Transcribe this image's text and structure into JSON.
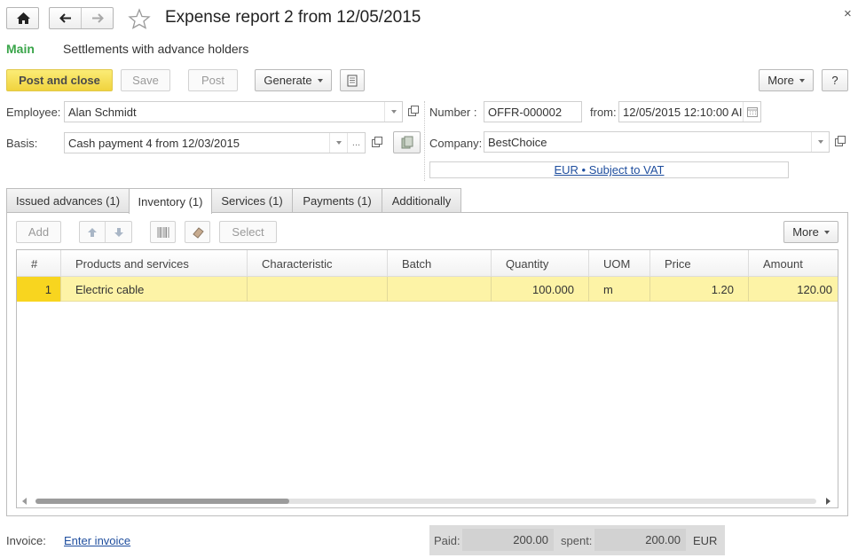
{
  "window": {
    "title": "Expense report 2 from 12/05/2015",
    "close_glyph": "×"
  },
  "nav": {
    "main_label": "Main",
    "settlements_label": "Settlements with advance holders"
  },
  "toolbar": {
    "post_close_label": "Post and close",
    "save_label": "Save",
    "post_label": "Post",
    "generate_label": "Generate",
    "more_label": "More",
    "help_label": "?"
  },
  "form": {
    "employee_label": "Employee:",
    "employee_value": "Alan Schmidt",
    "basis_label": "Basis:",
    "basis_value": "Cash payment 4 from 12/03/2015",
    "basis_ellipsis": "...",
    "number_label": "Number :",
    "number_value": "OFFR-000002",
    "from_label": "from:",
    "from_value": "12/05/2015 12:10:00 AI",
    "company_label": "Company:",
    "company_value": "BestChoice",
    "currency_link": "EUR • Subject to VAT"
  },
  "tabs": [
    {
      "label": "Issued advances (1)"
    },
    {
      "label": "Inventory (1)"
    },
    {
      "label": "Services (1)"
    },
    {
      "label": "Payments (1)"
    },
    {
      "label": "Additionally"
    }
  ],
  "table_toolbar": {
    "add_label": "Add",
    "select_label": "Select",
    "more_label": "More"
  },
  "table": {
    "columns": [
      "#",
      "Products and services",
      "Characteristic",
      "Batch",
      "Quantity",
      "UOM",
      "Price",
      "Amount"
    ],
    "rows": [
      {
        "num": "1",
        "product": "Electric cable",
        "characteristic": "",
        "batch": "",
        "quantity": "100.000",
        "uom": "m",
        "price": "1.20",
        "amount": "120.00"
      }
    ]
  },
  "footer": {
    "invoice_label": "Invoice:",
    "invoice_link": "Enter invoice",
    "paid_label": "Paid:",
    "paid_value": "200.00",
    "spent_label": "spent:",
    "spent_value": "200.00",
    "currency": "EUR"
  },
  "colors": {
    "main_green": "#3aa54a",
    "primary_button": "#f2d948",
    "selected_row": "#fdf3a6",
    "row_number_cell": "#f8d51f",
    "link_blue": "#1f4e9e"
  }
}
